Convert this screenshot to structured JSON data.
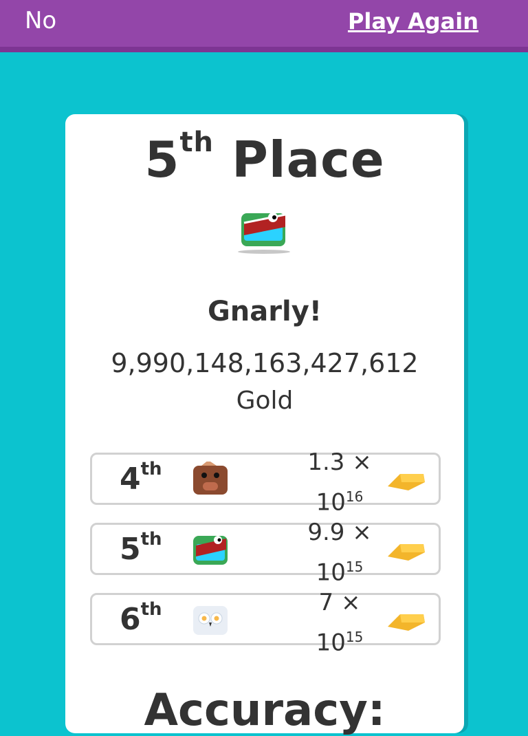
{
  "topbar": {
    "no_label": "No",
    "play_again_label": "Play Again"
  },
  "result": {
    "place_number": "5",
    "place_suffix": "th",
    "place_word": "Place",
    "praise": "Gnarly!",
    "gold_amount": "9,990,148,163,427,612",
    "gold_label": "Gold"
  },
  "ranks": [
    {
      "place": "4",
      "suffix": "th",
      "avatar": "boar-avatar-icon",
      "mantissa": "1.3 ×",
      "base": "10",
      "exp": "16"
    },
    {
      "place": "5",
      "suffix": "th",
      "avatar": "crocodile-avatar-icon",
      "mantissa": "9.9 ×",
      "base": "10",
      "exp": "15"
    },
    {
      "place": "6",
      "suffix": "th",
      "avatar": "owl-avatar-icon",
      "mantissa": "7 ×",
      "base": "10",
      "exp": "15"
    }
  ],
  "footer": {
    "accuracy_label": "Accuracy:"
  },
  "colors": {
    "background": "#0cc3cf",
    "topbar": "#9346a9",
    "text": "#333333",
    "gold": "#f3b52b"
  }
}
